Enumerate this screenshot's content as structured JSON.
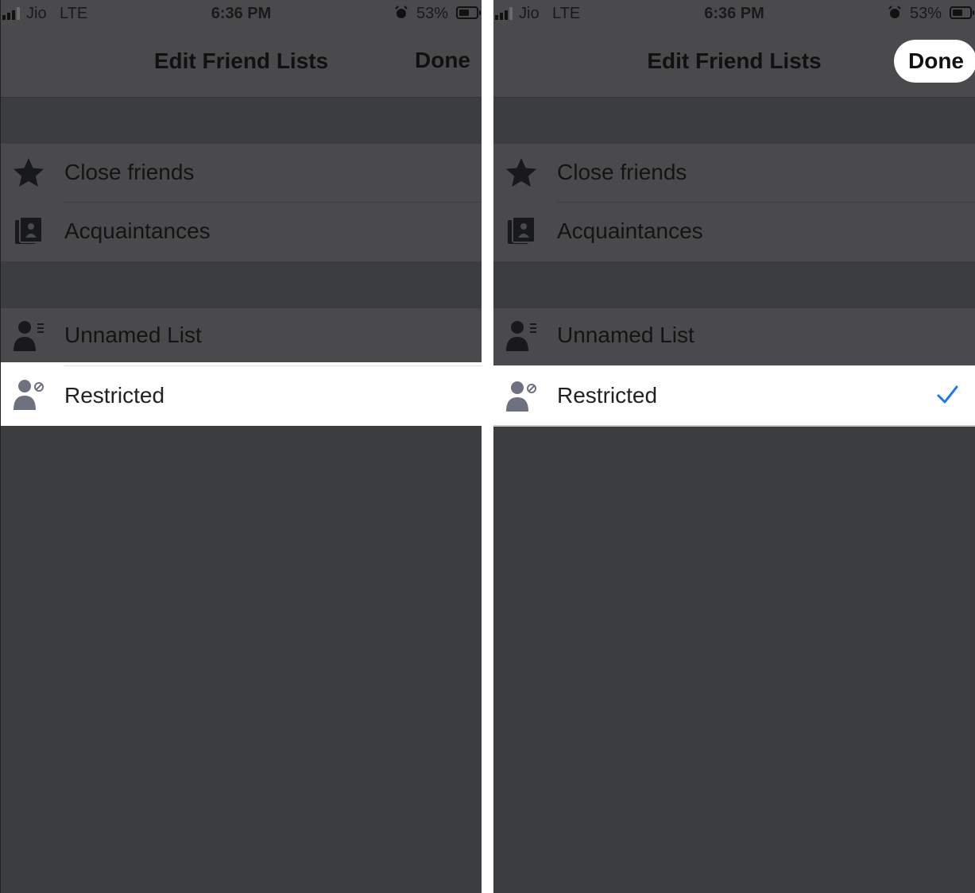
{
  "status_bar": {
    "carrier": "Jio",
    "network": "LTE",
    "time": "6:36 PM",
    "battery": "53%"
  },
  "header": {
    "title": "Edit Friend Lists",
    "done_label": "Done"
  },
  "lists": {
    "close_friends": "Close friends",
    "acquaintances": "Acquaintances",
    "unnamed_list": "Unnamed List",
    "restricted": "Restricted"
  },
  "icons": {
    "close_friends": "star-icon",
    "acquaintances": "id-card-icon",
    "unnamed_list": "person-list-icon",
    "restricted": "person-blocked-icon",
    "selected": "checkmark-icon"
  },
  "colors": {
    "checkmark": "#1877f2",
    "icon": "#6e7280",
    "dimmed_overlay": "#4a4a4c"
  },
  "panels": [
    {
      "step": "before",
      "restricted_selected": false,
      "done_highlighted": false
    },
    {
      "step": "after",
      "restricted_selected": true,
      "done_highlighted": true
    }
  ]
}
